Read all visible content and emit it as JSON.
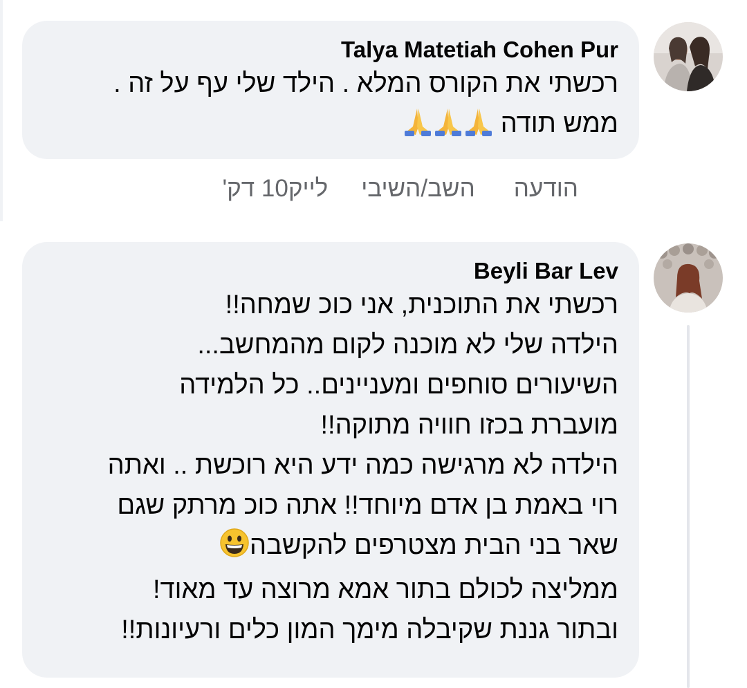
{
  "comments": [
    {
      "author": "Talya Matetiah Cohen Pur",
      "lines": [
        "רכשתי את הקורס המלא . הילד שלי עף על זה .",
        "ממש תודה"
      ],
      "emoji": "folded-hands-icon x3",
      "actions": {
        "time": "10 דק'",
        "like": "לייק",
        "reply": "השב/השיבי",
        "message": "הודעה"
      }
    },
    {
      "author": "Beyli Bar Lev",
      "lines": [
        "רכשתי את התוכנית, אני כוכ שמחה!!",
        "הילדה שלי לא מוכנה לקום מהמחשב...",
        "השיעורים סוחפים ומעניינים.. כל הלמידה",
        "מועברת בכזו חוויה מתוקה!!",
        "הילדה לא מרגישה כמה ידע היא רוכשת .. ואתה",
        "רוי באמת בן אדם מיוחד!! אתה כוכ מרתק שגם",
        "שאר בני הבית מצטרפים להקשבה",
        "ממליצה לכולם בתור אמא מרוצה עד מאוד!",
        "ובתור גננת שקיבלה מימך המון כלים ורעיונות!!"
      ],
      "emoji": "grinning-face-icon"
    }
  ],
  "colors": {
    "bubble": "#f0f2f5",
    "text": "#050505",
    "meta": "#65676b"
  }
}
